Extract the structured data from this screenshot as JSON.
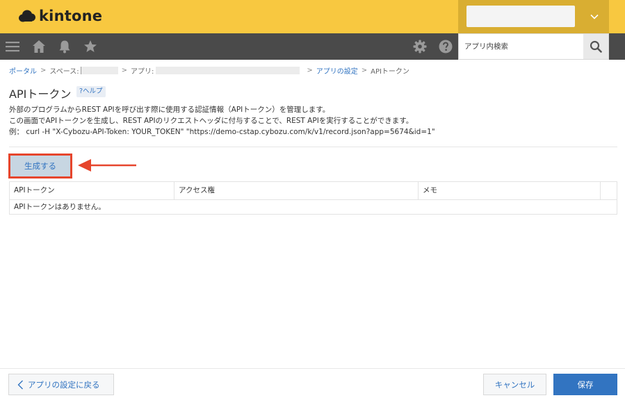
{
  "header": {
    "logo_text": "kintone",
    "brand_color": "#f8c840",
    "user_menu_icon": "chevron-down-icon"
  },
  "toolbar": {
    "icons": [
      "menu-icon",
      "home-icon",
      "bell-icon",
      "star-icon",
      "gear-icon",
      "help-icon",
      "search-icon"
    ],
    "search_placeholder": "アプリ内検索"
  },
  "breadcrumb": {
    "portal": "ポータル",
    "space_label": "スペース:",
    "app_label": "アプリ:",
    "app_settings": "アプリの設定",
    "current": "APIトークン",
    "separator": ">"
  },
  "page": {
    "title": "APIトークン",
    "help": "?ヘルプ",
    "description_lines": [
      "外部のプログラムからREST APIを呼び出す際に使用する認証情報（APIトークン）を管理します。",
      "この画面でAPIトークンを生成し、REST APIのリクエストヘッダに付与することで、REST APIを実行することができます。",
      "例：  curl -H \"X-Cybozu-API-Token: YOUR_TOKEN\" \"https://demo-cstap.cybozu.com/k/v1/record.json?app=5674&id=1\""
    ],
    "generate_button": "生成する",
    "highlight_color": "#e6452c"
  },
  "table": {
    "columns": [
      "APIトークン",
      "アクセス権",
      "メモ"
    ],
    "empty_message": "APIトークンはありません。"
  },
  "footer": {
    "back_button": "アプリの設定に戻る",
    "cancel_button": "キャンセル",
    "save_button": "保存",
    "accent_color": "#3274c1"
  }
}
